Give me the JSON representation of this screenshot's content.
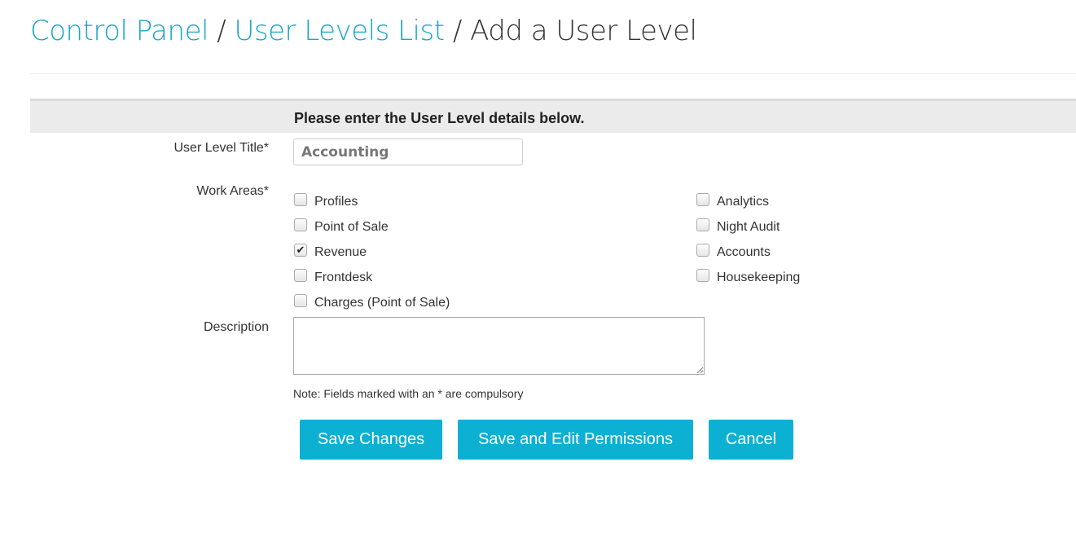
{
  "breadcrumb": {
    "items": [
      "Control Panel",
      "User Levels List"
    ],
    "current": "Add a User Level",
    "separator": " / "
  },
  "form": {
    "header": "Please enter the User Level details below.",
    "title_label": "User Level Title*",
    "title_value": "Accounting",
    "work_areas_label": "Work Areas*",
    "work_areas_left": [
      {
        "label": "Profiles",
        "checked": false
      },
      {
        "label": "Point of Sale",
        "checked": false
      },
      {
        "label": "Revenue",
        "checked": true
      },
      {
        "label": "Frontdesk",
        "checked": false
      },
      {
        "label": "Charges (Point of Sale)",
        "checked": false
      }
    ],
    "work_areas_right": [
      {
        "label": "Analytics",
        "checked": false
      },
      {
        "label": "Night Audit",
        "checked": false
      },
      {
        "label": "Accounts",
        "checked": false
      },
      {
        "label": "Housekeeping",
        "checked": false
      }
    ],
    "description_label": "Description",
    "description_value": "",
    "note": "Note: Fields marked with an * are compulsory"
  },
  "buttons": {
    "save": "Save Changes",
    "save_edit": "Save and Edit Permissions",
    "cancel": "Cancel"
  },
  "colors": {
    "accent": "#0bb0d3",
    "link": "#1aa6c8"
  }
}
